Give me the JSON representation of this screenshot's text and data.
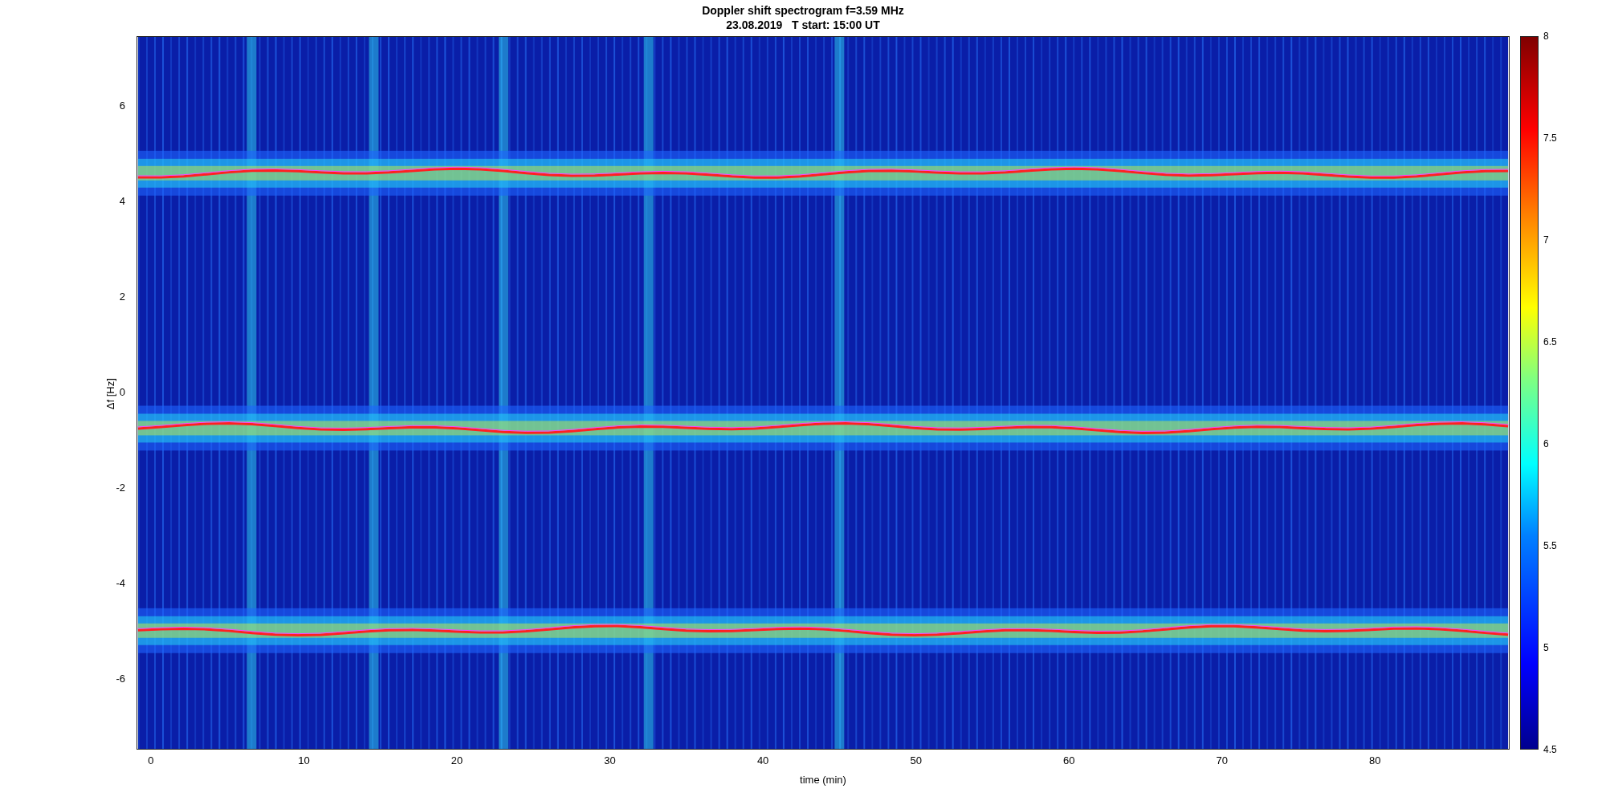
{
  "title": {
    "line1": "Doppler shift spectrogram f=3.59 MHz",
    "line2": "23.08.2019   T start: 15:00 UT"
  },
  "axes": {
    "ylabel": "Δf [Hz]",
    "xlabel": "time (min)",
    "xticks": [
      "0",
      "10",
      "20",
      "30",
      "40",
      "50",
      "60",
      "70",
      "80"
    ],
    "yticks": [
      "6",
      "4",
      "2",
      "0",
      "-2",
      "-4",
      "-6"
    ]
  },
  "colorbar": {
    "ticks": [
      "8",
      "7.5",
      "7",
      "6.5",
      "6",
      "5.5",
      "5",
      "4.5"
    ]
  }
}
